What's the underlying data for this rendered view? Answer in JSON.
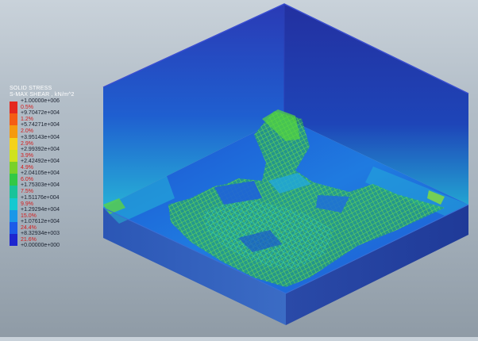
{
  "legend": {
    "title_line1": "SOLID STRESS",
    "title_line2": "S-MAX SHEAR , kN/m^2",
    "entries": [
      {
        "value": "+1.00000e+006",
        "percent": "0.5%",
        "color": "#e4291f"
      },
      {
        "value": "+9.70472e+004",
        "percent": "1.2%",
        "color": "#f45d14"
      },
      {
        "value": "+5.74271e+004",
        "percent": "2.0%",
        "color": "#f59a0f"
      },
      {
        "value": "+3.95143e+004",
        "percent": "2.9%",
        "color": "#f5d21a"
      },
      {
        "value": "+2.99392e+004",
        "percent": "3.9%",
        "color": "#cfe21d"
      },
      {
        "value": "+2.42492e+004",
        "percent": "4.9%",
        "color": "#79d12a"
      },
      {
        "value": "+2.04105e+004",
        "percent": "6.0%",
        "color": "#33c845"
      },
      {
        "value": "+1.75303e+004",
        "percent": "7.5%",
        "color": "#19c39a"
      },
      {
        "value": "+1.51176e+004",
        "percent": "9.9%",
        "color": "#14c9d1"
      },
      {
        "value": "+1.29294e+004",
        "percent": "15.0%",
        "color": "#1a97e8"
      },
      {
        "value": "+1.07612e+004",
        "percent": "24.4%",
        "color": "#1c5be8"
      },
      {
        "value": "+8.32934e+003",
        "percent": "21.6%",
        "color": "#1e26cf"
      },
      {
        "value": "+0.00000e+000",
        "percent": "",
        "color": "#1a1ab8"
      }
    ]
  },
  "model_colors": {
    "wall_top": "#2233a8",
    "wall_bottom": "#1f6fd6",
    "floor": "#1e64d9",
    "slab_side": "#2f55b8",
    "hotspot": "#43d33b"
  }
}
